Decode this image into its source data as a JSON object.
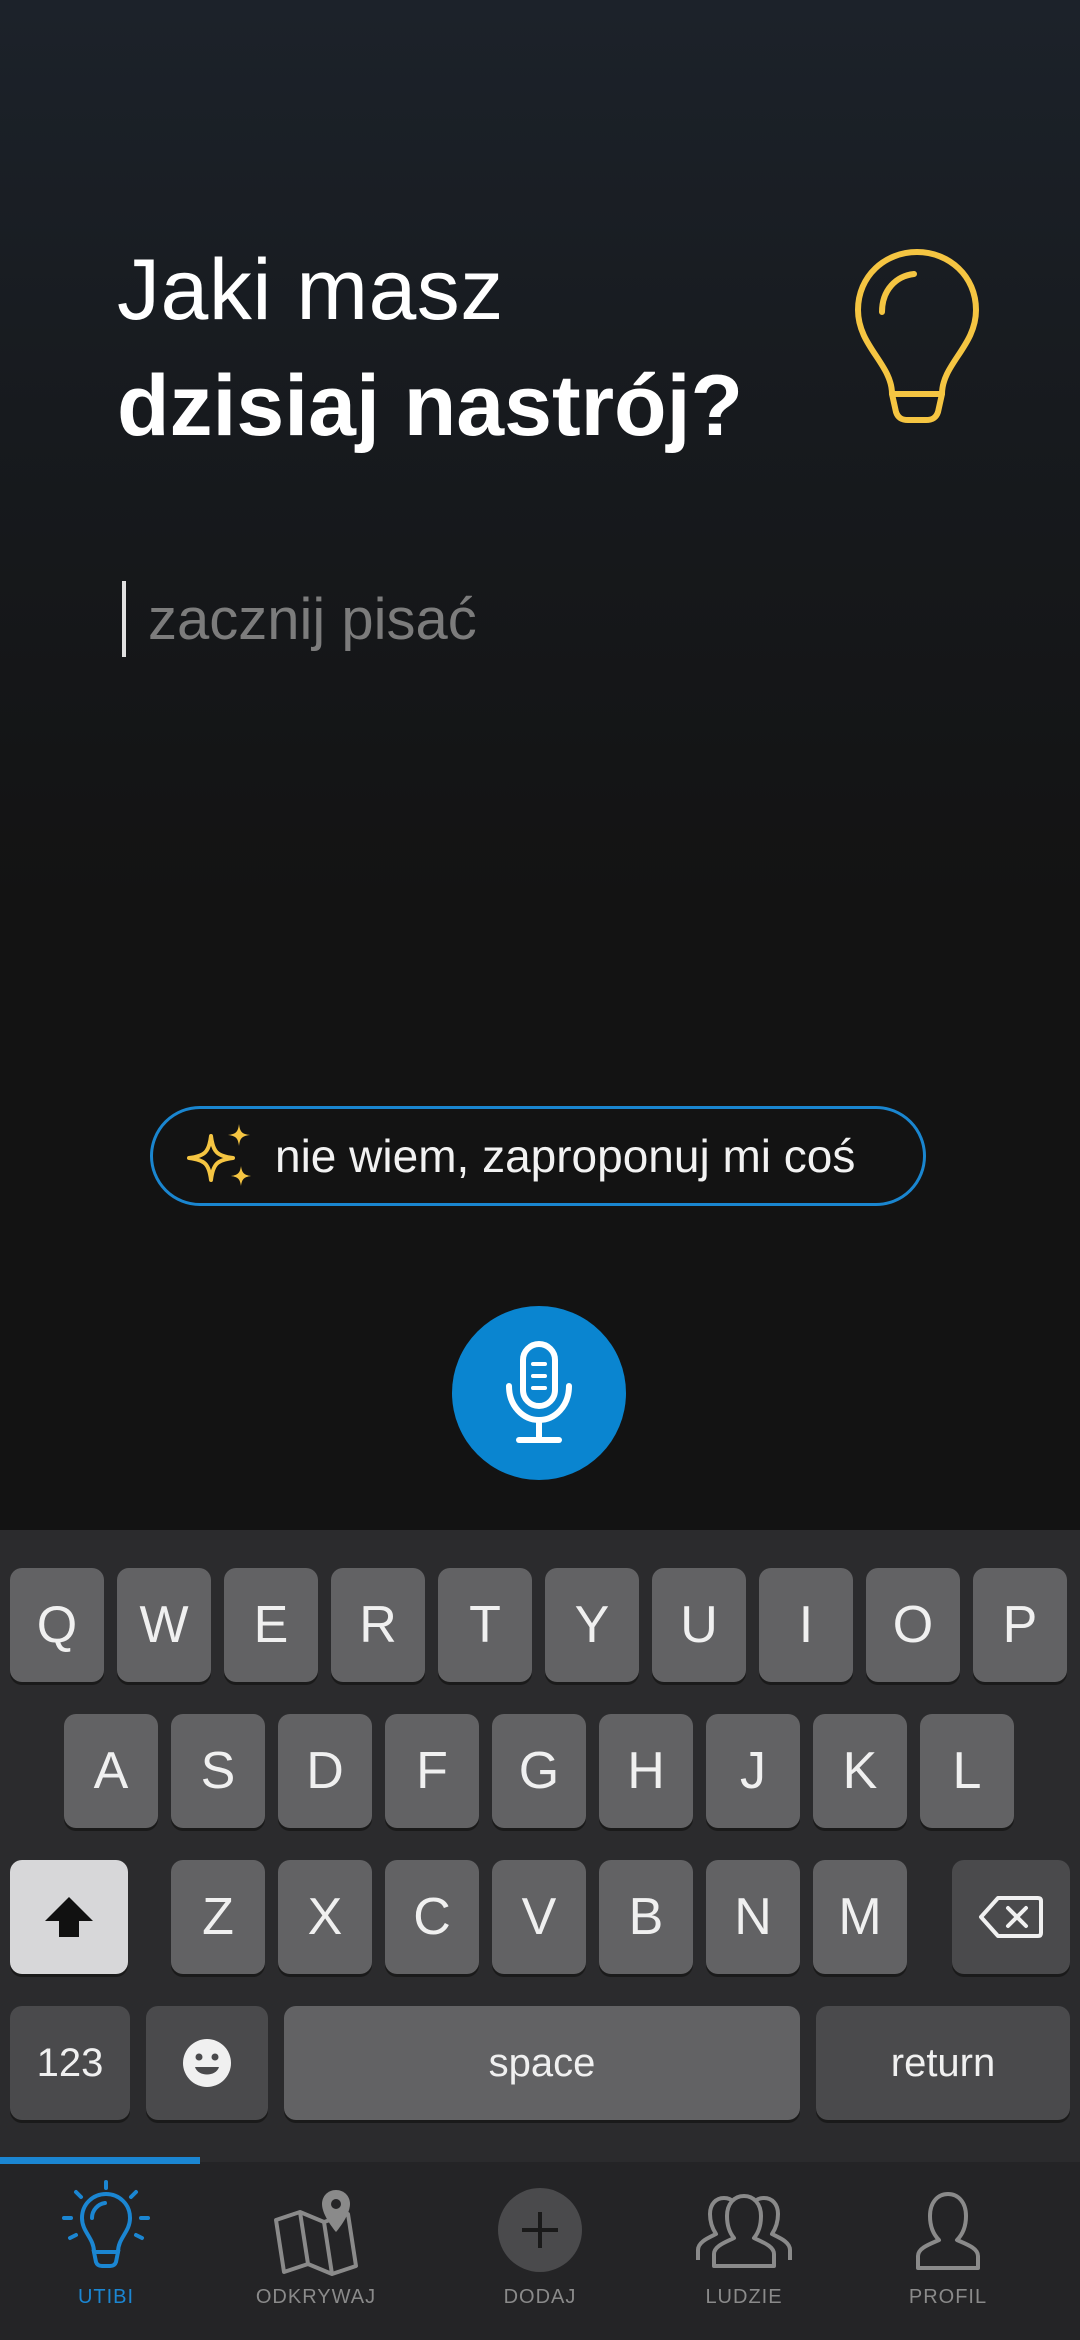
{
  "prompt": {
    "line1": "Jaki masz",
    "line2": "dzisiaj nastrój?"
  },
  "input": {
    "placeholder": "zacznij pisać"
  },
  "suggestion": {
    "label": "nie wiem, zaproponuj mi coś"
  },
  "keyboard": {
    "row1": [
      "Q",
      "W",
      "E",
      "R",
      "T",
      "Y",
      "U",
      "I",
      "O",
      "P"
    ],
    "row2": [
      "A",
      "S",
      "D",
      "F",
      "G",
      "H",
      "J",
      "K",
      "L"
    ],
    "row3": [
      "Z",
      "X",
      "C",
      "V",
      "B",
      "N",
      "M"
    ],
    "numbers_label": "123",
    "space_label": "space",
    "return_label": "return"
  },
  "tabs": [
    {
      "label": "UTIBI",
      "icon": "lightbulb-icon",
      "active": true
    },
    {
      "label": "ODKRYWAJ",
      "icon": "map-icon",
      "active": false
    },
    {
      "label": "DODAJ",
      "icon": "plus-icon",
      "active": false
    },
    {
      "label": "LUDZIE",
      "icon": "people-icon",
      "active": false
    },
    {
      "label": "PROFIL",
      "icon": "profile-icon",
      "active": false
    }
  ],
  "colors": {
    "accent": "#1b86d2",
    "bulb": "#f5c542",
    "background": "#131313"
  }
}
